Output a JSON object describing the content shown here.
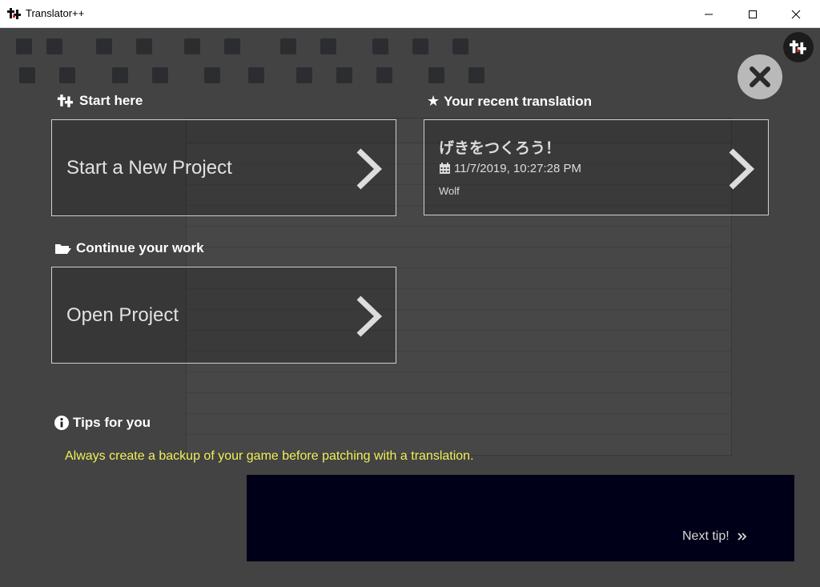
{
  "window": {
    "title": "Translator++"
  },
  "welcome": {
    "start_section": {
      "heading": "Start here",
      "card_label": "Start a New Project"
    },
    "continue_section": {
      "heading": "Continue your work",
      "card_label": "Open Project"
    },
    "recent_section": {
      "heading": "Your recent translation",
      "item": {
        "title": "げきをつくろう！",
        "datetime": "11/7/2019, 10:27:28 PM",
        "engine": "Wolf"
      }
    },
    "tips_section": {
      "heading": "Tips for you",
      "tip": "Always create a backup of your game before patching with a translation.",
      "next_label": "Next tip!"
    }
  },
  "colors": {
    "tip_text": "#f2ef5a",
    "overlay": "#000000",
    "lower_panel": "#000018"
  }
}
